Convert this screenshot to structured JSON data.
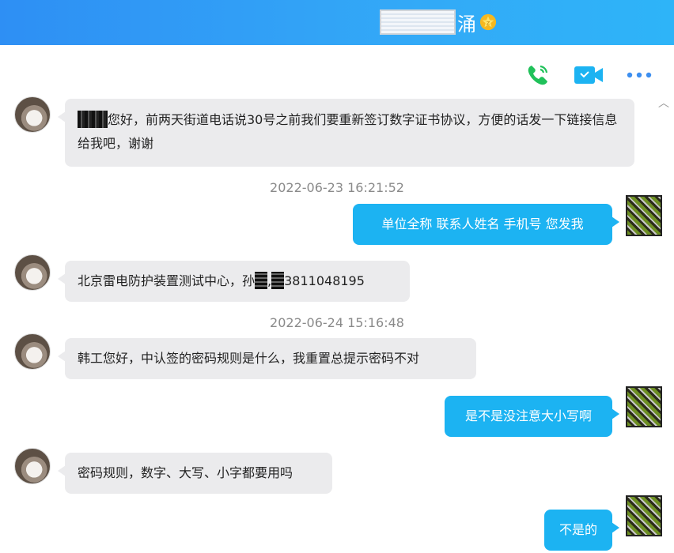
{
  "header": {
    "title_suffix": "涌",
    "badge_icon": "star-badge-icon"
  },
  "toolbar": {
    "phone_icon": "phone-icon",
    "video_icon": "video-camera-icon",
    "more_icon": "more-options-icon"
  },
  "messages": [
    {
      "side": "left",
      "text": "您好，前两天街道电话说30号之前我们要重新签订数字证书协议，方便的话发一下链接信息给我吧，谢谢"
    },
    {
      "timestamp": "2022-06-23 16:21:52"
    },
    {
      "side": "right",
      "text": "单位全称  联系人姓名 手机号 您发我"
    },
    {
      "side": "left",
      "text_a": "北京雷电防护装置测试中心，孙",
      "text_b": "3811048195"
    },
    {
      "timestamp": "2022-06-24 15:16:48"
    },
    {
      "side": "left",
      "text": "韩工您好，中认签的密码规则是什么，我重置总提示密码不对"
    },
    {
      "side": "right",
      "text": "是不是没注意大小写啊"
    },
    {
      "side": "left",
      "text": "密码规则，数字、大写、小字都要用吗"
    },
    {
      "side": "right",
      "text": "不是的"
    }
  ],
  "colors": {
    "header_start": "#2e8ff4",
    "header_end": "#2eb4f8",
    "bubble_right": "#1cb3f2",
    "bubble_left": "#ebebed",
    "phone_green": "#20c15a",
    "video_blue": "#1cb3f2"
  }
}
